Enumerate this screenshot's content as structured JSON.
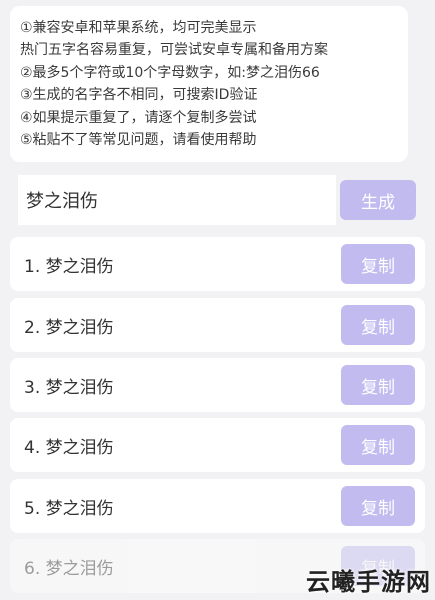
{
  "info": {
    "lines": [
      "①兼容安卓和苹果系统，均可完美显示",
      "热门五字名容易重复，可尝试安卓专属和备用方案",
      "②最多5个字符或10个字母数字，如:梦之泪伤66",
      "③生成的名字各不相同，可搜索ID验证",
      "④如果提示重复了，请逐个复制多尝试",
      "⑤粘贴不了等常见问题，请看使用帮助"
    ]
  },
  "input": {
    "value": "梦之泪伤"
  },
  "generate_label": "生成",
  "results": [
    {
      "text": "1. 梦之泪伤",
      "copy_label": "复制"
    },
    {
      "text": "2. 梦之泪伤",
      "copy_label": "复制"
    },
    {
      "text": "3. 梦之泪伤",
      "copy_label": "复制"
    },
    {
      "text": "4. 梦之泪伤",
      "copy_label": "复制"
    },
    {
      "text": "5. 梦之泪伤",
      "copy_label": "复制"
    },
    {
      "text": "6. 梦之泪伤",
      "copy_label": "复制"
    }
  ],
  "watermark": "云曦手游网",
  "colors": {
    "page_background": "#f2f2f4",
    "button_background": "#c2bbf0",
    "button_text": "#ffffff"
  }
}
